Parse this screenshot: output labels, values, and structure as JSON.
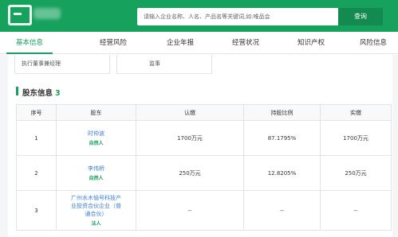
{
  "header": {
    "search_placeholder": "请输入企业名称、人名、产品名等关键词,如:唯品会",
    "search_button": "查询"
  },
  "nav": {
    "tabs": [
      "基本信息",
      "经营风险",
      "企业年报",
      "经营状况",
      "知识产权",
      "风险信息"
    ],
    "active_index": 0
  },
  "persons": [
    "执行董事兼经理",
    "监事"
  ],
  "shareholders": {
    "title": "股东信息",
    "count": "3",
    "columns": [
      "序号",
      "股东",
      "认缴",
      "持股比例",
      "实缴"
    ],
    "rows": [
      {
        "index": "1",
        "name": "时仲波",
        "tag": "自然人",
        "subscribed": "1700万元",
        "ratio": "87.1795%",
        "paid": "1700万元"
      },
      {
        "index": "2",
        "name": "李伟桥",
        "tag": "自然人",
        "subscribed": "250万元",
        "ratio": "12.8205%",
        "paid": "250万元"
      },
      {
        "index": "3",
        "name": "广州水木愉号科技产业投资合伙企业（普通合伙）",
        "tag": "法人",
        "subscribed": "--",
        "ratio": "--",
        "paid": "--"
      }
    ]
  },
  "colors": {
    "brand": "#16a15d",
    "link": "#3d7fd6"
  }
}
